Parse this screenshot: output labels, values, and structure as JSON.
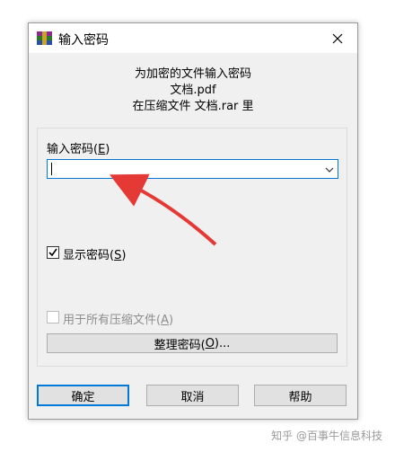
{
  "window": {
    "title": "输入密码",
    "close_icon": "close-icon",
    "app_icon": "winrar-icon"
  },
  "message": {
    "line1": "为加密的文件输入密码",
    "line2": "文档.pdf",
    "line3": "在压缩文件 文档.rar 里"
  },
  "password": {
    "label_text": "输入密码(",
    "label_hotkey": "E",
    "label_end": ")",
    "value": ""
  },
  "show_password": {
    "label_text": "显示密码(",
    "label_hotkey": "S",
    "label_end": ")",
    "checked": true
  },
  "use_for_all": {
    "label_text": "用于所有压缩文件(",
    "label_hotkey": "A",
    "label_end": ")",
    "checked": false,
    "enabled": false
  },
  "organize_button": {
    "label_text": "整理密码(",
    "label_hotkey": "O",
    "label_end": ")..."
  },
  "buttons": {
    "ok": "确定",
    "cancel": "取消",
    "help": "帮助"
  },
  "watermark": "知乎 @百事牛信息科技",
  "colors": {
    "accent": "#0078d7",
    "annotation_arrow": "#e53935",
    "dialog_bg": "#f0f0f0"
  }
}
